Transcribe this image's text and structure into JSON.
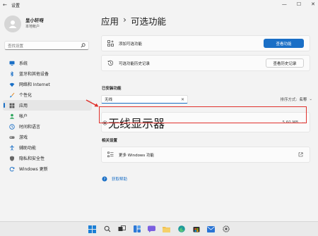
{
  "window": {
    "title": "设置",
    "back": "←",
    "minimize": "—",
    "maximize": "☐",
    "close": "✕"
  },
  "user": {
    "name": "呈小轩呀",
    "subtitle": "本地帐户"
  },
  "search": {
    "placeholder": "查找设置"
  },
  "nav": [
    {
      "label": "系统",
      "icon": "monitor-icon",
      "color": "#1a6fc6"
    },
    {
      "label": "蓝牙和其他设备",
      "icon": "bluetooth-icon",
      "color": "#1a6fc6"
    },
    {
      "label": "网络和 Internet",
      "icon": "wifi-icon",
      "color": "#1a6fc6"
    },
    {
      "label": "个性化",
      "icon": "brush-icon",
      "color": "#e08a2c"
    },
    {
      "label": "应用",
      "icon": "apps-icon",
      "color": "#555555",
      "active": true
    },
    {
      "label": "帐户",
      "icon": "person-icon",
      "color": "#2aa55a"
    },
    {
      "label": "时间和语言",
      "icon": "globe-clock-icon",
      "color": "#1a6fc6"
    },
    {
      "label": "游戏",
      "icon": "gamepad-icon",
      "color": "#777777"
    },
    {
      "label": "辅助功能",
      "icon": "accessibility-icon",
      "color": "#1a6fc6"
    },
    {
      "label": "隐私和安全性",
      "icon": "shield-icon",
      "color": "#666666"
    },
    {
      "label": "Windows 更新",
      "icon": "update-icon",
      "color": "#1a6fc6"
    }
  ],
  "breadcrumb": {
    "parent": "应用",
    "separator": "›",
    "current": "可选功能"
  },
  "add_feature": {
    "label": "添加可选功能",
    "button": "查看功能"
  },
  "history": {
    "label": "可选功能历史记录",
    "button": "查看历史记录"
  },
  "installed": {
    "title": "已安装功能",
    "filter_value": "无线",
    "sort_label": "排序方式:",
    "sort_value": "名称",
    "items": [
      {
        "name": "无线显示器",
        "size": "5.60 MB"
      }
    ]
  },
  "related": {
    "title": "相关设置",
    "more_label": "更多 Windows 功能"
  },
  "help": {
    "label": "获取帮助"
  },
  "accent_color": "#1a6fc6",
  "highlight_color": "#e0302b"
}
